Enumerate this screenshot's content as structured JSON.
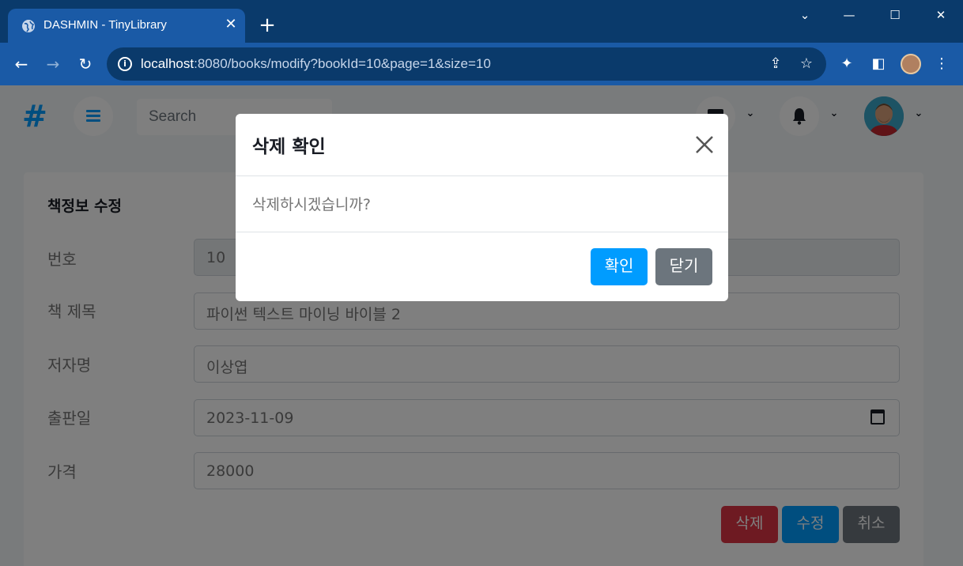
{
  "browser": {
    "tab_title": "DASHMIN - TinyLibrary",
    "tab_close": "✕",
    "new_tab": "+",
    "url_host": "localhost",
    "url_rest": ":8080/books/modify?bookId=10&page=1&size=10"
  },
  "header": {
    "logo": "#",
    "search_placeholder": "Search"
  },
  "form": {
    "title": "책정보 수정",
    "fields": [
      {
        "label": "번호",
        "value": "10",
        "readonly": true
      },
      {
        "label": "책 제목",
        "value": "파이썬 텍스트 마이닝 바이블 2"
      },
      {
        "label": "저자명",
        "value": "이상엽"
      },
      {
        "label": "출판일",
        "value": "2023-11-09"
      },
      {
        "label": "가격",
        "value": "28000"
      }
    ],
    "buttons": {
      "delete": "삭제",
      "modify": "수정",
      "cancel": "취소"
    }
  },
  "modal": {
    "title": "삭제 확인",
    "body": "삭제하시겠습니까?",
    "confirm": "확인",
    "close": "닫기"
  },
  "colors": {
    "primary": "#009cff",
    "danger": "#dc3545",
    "secondary": "#6c757d",
    "chrome_dark": "#0a3a6b",
    "chrome_light": "#1a5aa6"
  }
}
